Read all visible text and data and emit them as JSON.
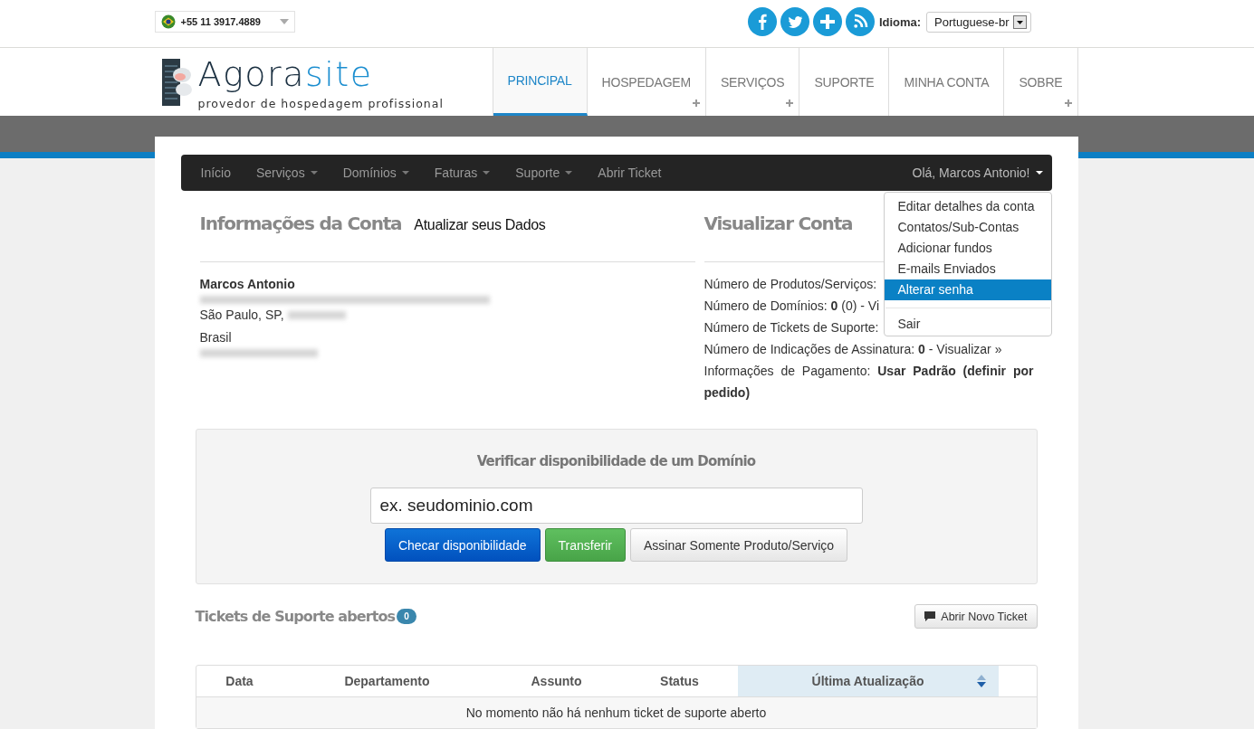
{
  "topbar": {
    "phone": "+55 11 3917.4889",
    "language_label": "Idioma:",
    "language": "Portuguese-br"
  },
  "logo": {
    "brand_dark": "Agora",
    "brand_light": "site",
    "tagline": "provedor de hospedagem profissional"
  },
  "main_nav": [
    {
      "label": "PRINCIPAL",
      "selected": true,
      "has_submenu": false
    },
    {
      "label": "HOSPEDAGEM",
      "selected": false,
      "has_submenu": true
    },
    {
      "label": "SERVIÇOS",
      "selected": false,
      "has_submenu": true
    },
    {
      "label": "SUPORTE",
      "selected": false,
      "has_submenu": false
    },
    {
      "label": "MINHA CONTA",
      "selected": false,
      "has_submenu": false
    },
    {
      "label": "SOBRE",
      "selected": false,
      "has_submenu": true
    }
  ],
  "account_nav": {
    "items": [
      {
        "label": "Início",
        "has_dropdown": false
      },
      {
        "label": "Serviços",
        "has_dropdown": true
      },
      {
        "label": "Domínios",
        "has_dropdown": true
      },
      {
        "label": "Faturas",
        "has_dropdown": true
      },
      {
        "label": "Suporte",
        "has_dropdown": true
      },
      {
        "label": "Abrir Ticket",
        "has_dropdown": false
      }
    ],
    "user_menu": {
      "label": "Olá, Marcos Antonio!",
      "expanded": true,
      "items": [
        {
          "label": "Editar detalhes da conta",
          "selected": false
        },
        {
          "label": "Contatos/Sub-Contas",
          "selected": false
        },
        {
          "label": "Adicionar fundos",
          "selected": false
        },
        {
          "label": "E-mails Enviados",
          "selected": false
        },
        {
          "label": "Alterar senha",
          "selected": true
        }
      ],
      "logout": "Sair"
    }
  },
  "account_info": {
    "title": "Informações da Conta",
    "link": "Atualizar seus Dados",
    "name": "Marcos Antonio",
    "lines": [
      {
        "kind": "redacted"
      },
      {
        "kind": "text",
        "text": "São Paulo, SP,",
        "redacted_suffix": true
      },
      {
        "kind": "text",
        "text": "Brasil",
        "redacted_suffix": false
      },
      {
        "kind": "redacted"
      }
    ]
  },
  "account_view": {
    "title": "Visualizar Conta",
    "lines": [
      "Número de Produtos/Serviços:",
      "Número de Domínios: **0** (0) - Vi",
      "Número de Tickets de Suporte:",
      "Número de Indicações de Assinatura: **0** - Visualizar »",
      "Informações de Pagamento: **Usar Padrão (definir por pedido)**"
    ]
  },
  "domain_check": {
    "title": "Verificar disponibilidade de um Domínio",
    "placeholder": "ex. seudominio.com",
    "buttons": [
      {
        "label": "Checar disponibilidade",
        "kind": "primary"
      },
      {
        "label": "Transferir",
        "kind": "success"
      },
      {
        "label": "Assinar Somente Produto/Serviço",
        "kind": "default"
      }
    ]
  },
  "tickets": {
    "title": "Tickets de Suporte abertos",
    "count": "0",
    "new_button": "Abrir Novo Ticket",
    "columns": [
      {
        "label": "Data",
        "sorted": false
      },
      {
        "label": "Departamento",
        "sorted": false
      },
      {
        "label": "Assunto",
        "sorted": false
      },
      {
        "label": "Status",
        "sorted": false
      },
      {
        "label": "Última Atualização",
        "sorted": true
      }
    ],
    "empty_message": "No momento não há nenhum ticket de suporte aberto"
  }
}
